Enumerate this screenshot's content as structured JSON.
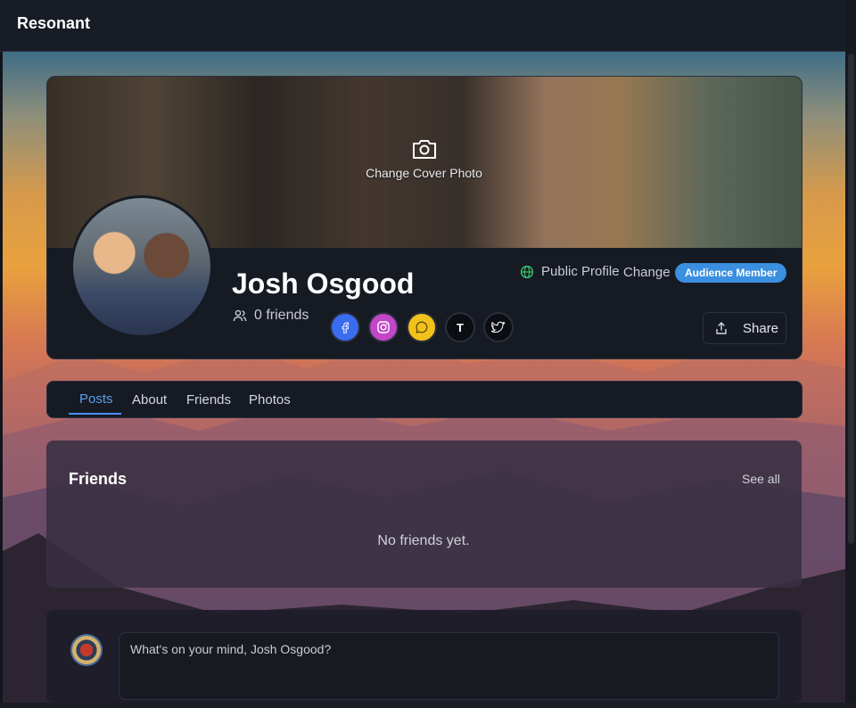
{
  "app": {
    "brand": "Resonant"
  },
  "cover": {
    "change_label": "Change Cover Photo"
  },
  "profile": {
    "name": "Josh Osgood",
    "friends_count": "0 friends",
    "visibility": "Public Profile",
    "change_label": "Change",
    "badge": "Audience Member",
    "share_label": "Share"
  },
  "socials": [
    {
      "name": "facebook",
      "icon": "facebook-icon",
      "color": "#3a6cf0"
    },
    {
      "name": "instagram",
      "icon": "instagram-icon",
      "color": "#c246c8"
    },
    {
      "name": "messenger",
      "icon": "chat-bubble-icon",
      "color": "#f2c21a"
    },
    {
      "name": "tiktok",
      "letter": "T",
      "color": "#0b0d12"
    },
    {
      "name": "twitter",
      "icon": "twitter-bird-icon",
      "color": "#0b0d12"
    }
  ],
  "tabs": [
    {
      "label": "Posts",
      "active": true
    },
    {
      "label": "About"
    },
    {
      "label": "Friends"
    },
    {
      "label": "Photos"
    }
  ],
  "friends_section": {
    "title": "Friends",
    "see_all": "See all",
    "empty": "No friends yet."
  },
  "composer": {
    "placeholder": "What's on your mind, Josh Osgood?"
  },
  "colors": {
    "accent": "#4b8ff0",
    "badge": "#3b8fe0",
    "public_globe": "#3cc26a"
  }
}
